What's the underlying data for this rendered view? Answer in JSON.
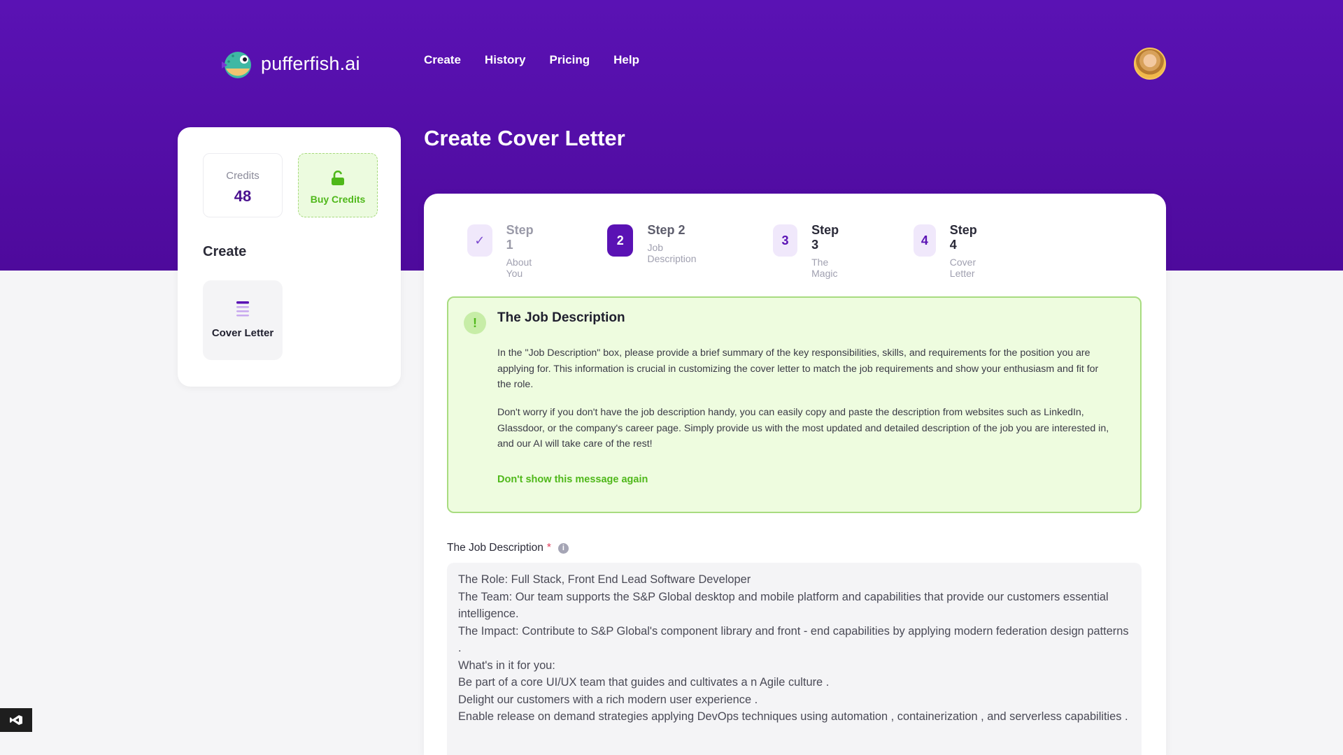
{
  "brand": {
    "name": "pufferfish.ai"
  },
  "nav": {
    "items": [
      "Create",
      "History",
      "Pricing",
      "Help"
    ]
  },
  "sidebar": {
    "credits_label": "Credits",
    "credits_value": "48",
    "buy_label": "Buy Credits",
    "section_heading": "Create",
    "tiles": [
      {
        "label": "Cover Letter",
        "icon": "document-lines-icon"
      }
    ]
  },
  "page": {
    "title": "Create Cover Letter"
  },
  "steps": [
    {
      "badge": "✓",
      "title": "Step 1",
      "subtitle": "About You",
      "state": "done"
    },
    {
      "badge": "2",
      "title": "Step 2",
      "subtitle": "Job Description",
      "state": "active"
    },
    {
      "badge": "3",
      "title": "Step 3",
      "subtitle": "The Magic",
      "state": "pending"
    },
    {
      "badge": "4",
      "title": "Step 4",
      "subtitle": "Cover Letter",
      "state": "pending"
    }
  ],
  "notice": {
    "icon": "!",
    "title": "The Job Description",
    "paragraph1": "In the \"Job Description\" box, please provide a brief summary of the key responsibilities, skills, and requirements for the position you are applying for. This information is crucial in customizing the cover letter to match the job requirements and show your enthusiasm and fit for the role.",
    "paragraph2": "Don't worry if you don't have the job description handy, you can easily copy and paste the description from websites such as LinkedIn, Glassdoor, or the company's career page. Simply provide us with the most updated and detailed description of the job you are interested in, and our AI will take care of the rest!",
    "dismiss_link": "Don't show this message again"
  },
  "job_field": {
    "label": "The Job Description",
    "required_mark": "*",
    "info": "i",
    "value": "The Role: Full Stack, Front End Lead Software Developer\nThe Team: Our team supports the S&P Global desktop and mobile platform and capabilities that provide our customers essential intelligence.\nThe Impact: Contribute to S&P Global's component library and front - end capabilities by applying modern federation design patterns .\nWhat's in it for you:\nBe part of a core UI/UX team that guides and cultivates a n Agile culture .\nDelight our customers with a rich modern user experience .\nEnable release on demand strategies applying DevOps techniques using automation , containerization , and serverless capabilities ."
  },
  "colors": {
    "primary": "#5a12b4",
    "success": "#4fb81a",
    "notice_bg": "#eefcdf",
    "notice_border": "#a8dc80"
  }
}
